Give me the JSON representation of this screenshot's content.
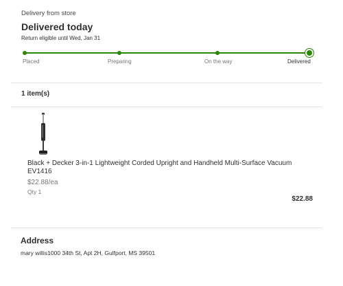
{
  "status": {
    "delivery_type": "Delivery from store",
    "title": "Delivered today",
    "return_note": "Return eligible until Wed, Jan 31"
  },
  "tracker": {
    "steps": [
      "Placed",
      "Preparing",
      "On the way",
      "Delivered"
    ],
    "current_step": "Delivered",
    "color": "#2a8703"
  },
  "items": {
    "count_label": "1 item(s)",
    "list": [
      {
        "name": "Black + Decker 3-in-1 Lightweight Corded Upright and Handheld Multi-Surface Vacuum EV1416",
        "unit_price": "$22.88/ea",
        "quantity": "Qty 1",
        "total": "$22.88",
        "image_icon": "stick-vacuum-image"
      }
    ]
  },
  "address": {
    "heading": "Address",
    "text": "mary willis1000 34th St, Apt 2H, Gulfport, MS 39501"
  }
}
